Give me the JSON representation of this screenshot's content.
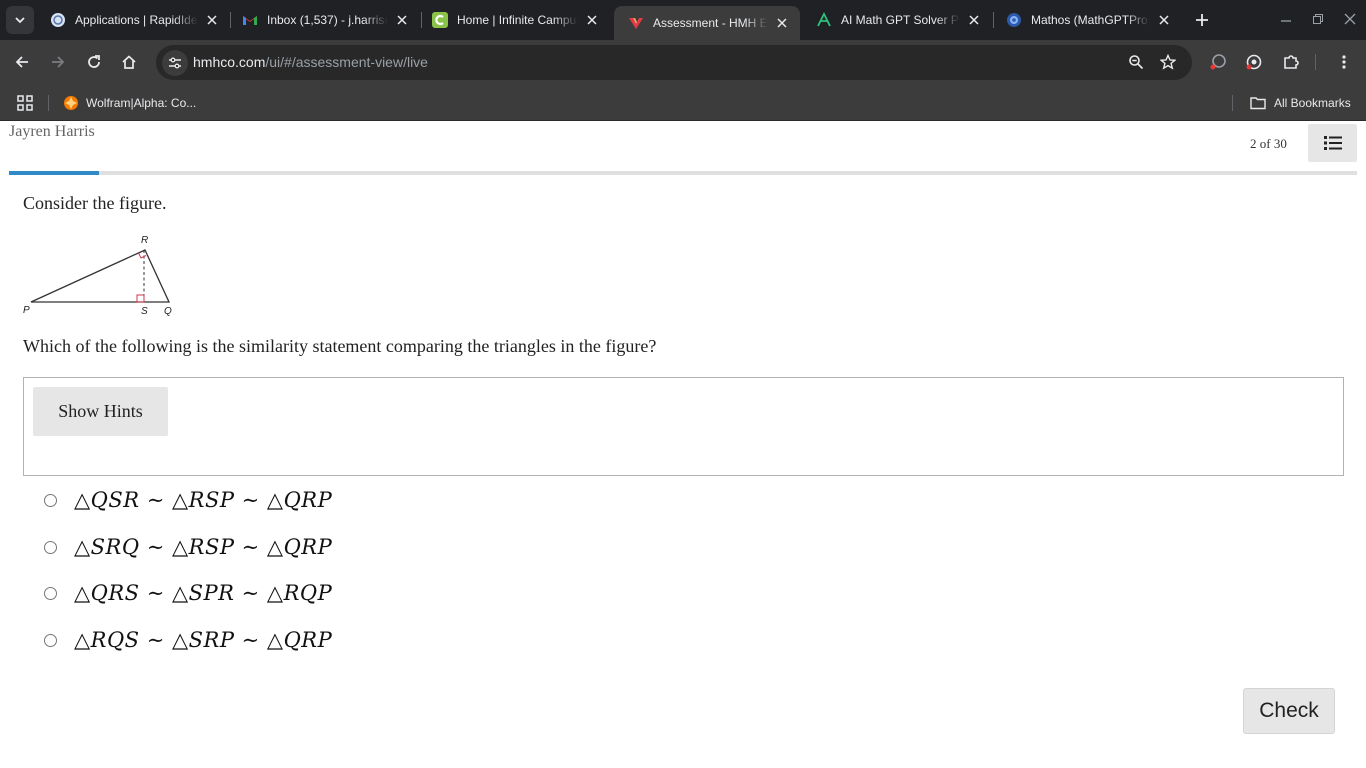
{
  "browser": {
    "tabs": [
      {
        "title": "Applications | RapidIdentity",
        "icon": "rapididentity-icon"
      },
      {
        "title": "Inbox (1,537) - j.harris@",
        "icon": "gmail-icon"
      },
      {
        "title": "Home | Infinite Campus",
        "icon": "infinite-campus-icon"
      },
      {
        "title": "Assessment - HMH Ed",
        "icon": "hmh-icon",
        "active": true
      },
      {
        "title": "AI Math GPT Solver Po",
        "icon": "math-gpt-icon"
      },
      {
        "title": "Mathos (MathGPTPro)",
        "icon": "mathos-icon"
      }
    ],
    "url_host": "hmhco.com",
    "url_path": "/ui/#/assessment-view/live",
    "bookmarks": {
      "first": "Wolfram|Alpha: Co...",
      "all": "All Bookmarks"
    }
  },
  "header": {
    "student_name": "Jayren Harris",
    "counter": "2 of 30",
    "progress_fraction": 0.067
  },
  "question": {
    "prompt": "Consider the figure.",
    "figure_labels": {
      "p": "P",
      "q": "Q",
      "r": "R",
      "s": "S"
    },
    "text": "Which of the following is the similarity statement comparing the triangles in the figure?",
    "hint_button": "Show Hints",
    "choices": [
      "△QSR ∼ △RSP ∼ △QRP",
      "△SRQ ∼ △RSP ∼ △QRP",
      "△QRS ∼ △SPR ∼ △RQP",
      "△RQS ∼ △SRP ∼ △QRP"
    ],
    "check_button": "Check"
  },
  "colors": {
    "progress": "#2f8ac8",
    "right_angle_marks": "#d2374f",
    "chrome_dark": "#202124",
    "chrome_toolbar": "#3c3c3c"
  }
}
